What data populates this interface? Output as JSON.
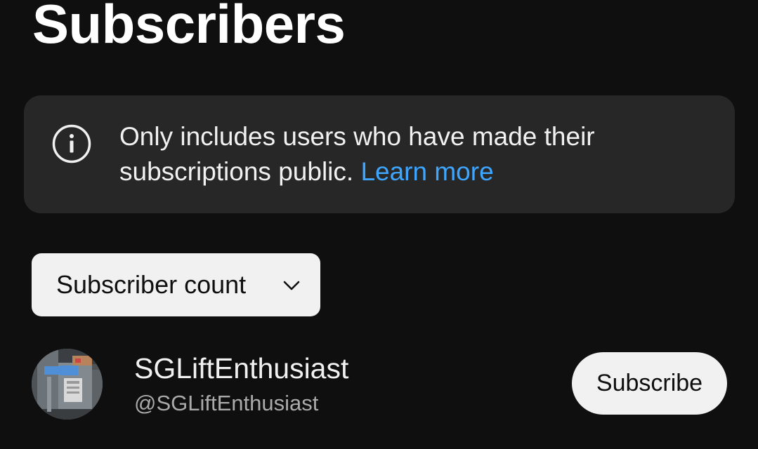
{
  "header": {
    "title": "Subscribers"
  },
  "info_banner": {
    "icon": "info-icon",
    "text": "Only includes users who have made their subscriptions public.",
    "link_text": "Learn more",
    "link_color": "#3ea6ff"
  },
  "sort": {
    "selected": "Subscriber count",
    "icon": "chevron-down-icon"
  },
  "subscribers": [
    {
      "name": "SGLiftEnthusiast",
      "handle": "@SGLiftEnthusiast",
      "button_label": "Subscribe"
    }
  ],
  "colors": {
    "background": "#0f0f0f",
    "card": "#272727",
    "chip": "#f1f1f1",
    "secondary_text": "#aaaaaa"
  }
}
